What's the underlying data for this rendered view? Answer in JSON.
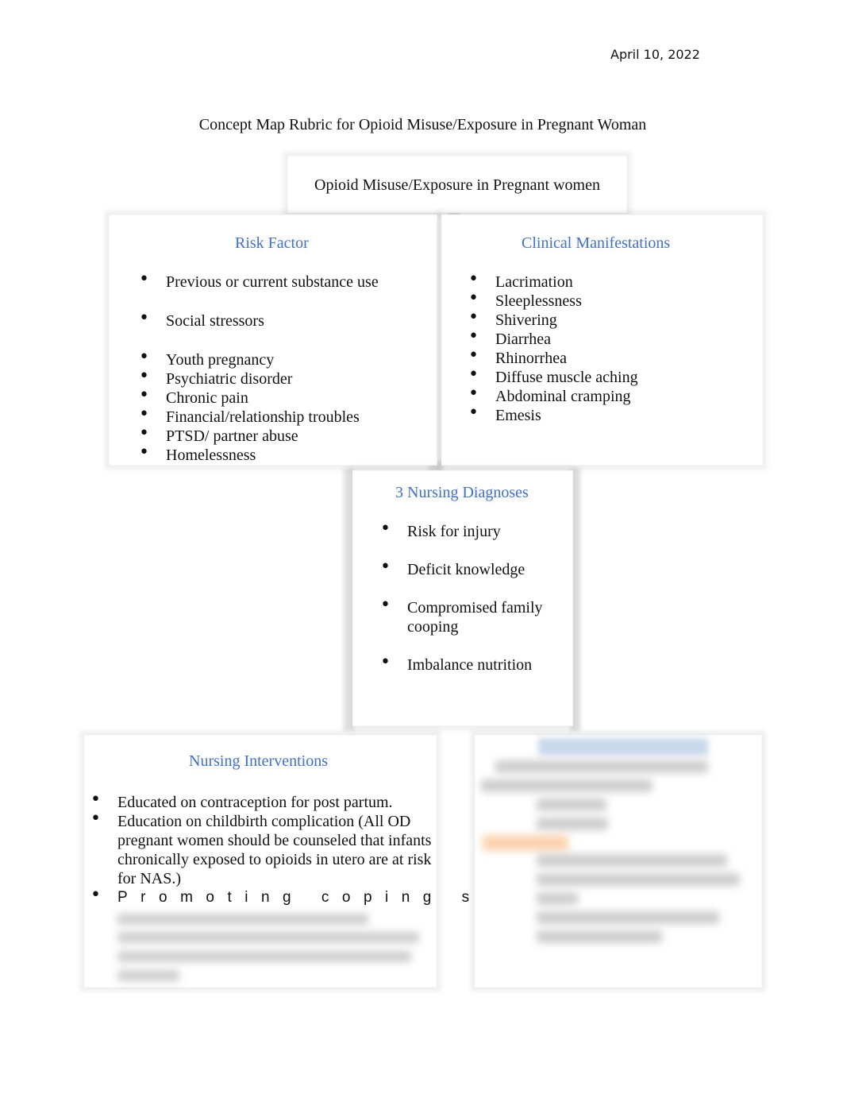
{
  "header": {
    "date": "April 10, 2022",
    "title": "Concept Map Rubric for Opioid Misuse/Exposure in Pregnant Woman"
  },
  "central_node": {
    "label": "Opioid Misuse/Exposure in Pregnant women"
  },
  "risk_factor": {
    "heading": "Risk Factor",
    "items": [
      "Previous or current substance use",
      "Social stressors",
      "Youth pregnancy",
      "Psychiatric disorder",
      "Chronic pain",
      "Financial/relationship troubles",
      "PTSD/ partner abuse",
      "Homelessness"
    ]
  },
  "clinical_manifestations": {
    "heading": "Clinical Manifestations",
    "items": [
      "Lacrimation",
      "Sleeplessness",
      "Shivering",
      "Diarrhea",
      "Rhinorrhea",
      "Diffuse muscle aching",
      "Abdominal cramping",
      "Emesis"
    ]
  },
  "nursing_diagnoses": {
    "heading": "3 Nursing Diagnoses",
    "items": [
      "Risk for injury",
      "Deficit knowledge",
      "Compromised family cooping",
      "Imbalance nutrition"
    ]
  },
  "nursing_interventions": {
    "heading": "Nursing Interventions",
    "items": [
      "Educated on contraception for post partum.",
      "Education on childbirth complication (All OD pregnant women should be counseled that infants chronically exposed to opioids in utero are at risk for NAS.)",
      "Promoting coping skills."
    ],
    "blurred_note": "[blurred content]"
  },
  "blurred_panel": {
    "note": "[blurred content]",
    "accent_heading_color": "#c9d8ea",
    "accent_highlight_color": "#fcd3b0"
  },
  "colors": {
    "heading": "#4472c4",
    "text": "#111111"
  }
}
